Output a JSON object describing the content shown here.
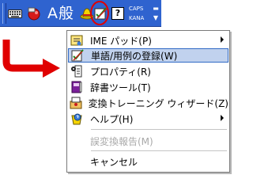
{
  "langbar": {
    "icons": {
      "keyboard": "keyboard-icon",
      "mode_button": "ime-toggle-icon",
      "tool": "ime-pad-hat-icon",
      "language": "register-word-icon",
      "help": "help-icon"
    },
    "input_mode": "A",
    "conversion_mode": "般",
    "help_label": "?",
    "caps_label": "CAPS",
    "kana_label": "KANA",
    "accent_color": "#2f63cf"
  },
  "menu": {
    "items": [
      {
        "label": "IME パッド(P)",
        "icon": "ime-pad-icon",
        "submenu": true,
        "enabled": true
      },
      {
        "label": "単語/用例の登録(W)",
        "icon": "register-word-icon",
        "submenu": false,
        "enabled": true,
        "highlighted": true
      },
      {
        "label": "プロパティ(R)",
        "icon": "properties-icon",
        "submenu": false,
        "enabled": true
      },
      {
        "label": "辞書ツール(T)",
        "icon": "dictionary-tool-icon",
        "submenu": false,
        "enabled": true
      },
      {
        "label": "変換トレーニング ウィザード(Z)",
        "icon": "training-wizard-icon",
        "submenu": false,
        "enabled": true
      },
      {
        "label": "ヘルプ(H)",
        "icon": "help-icon",
        "submenu": true,
        "enabled": true
      },
      {
        "label": "誤変換報告(M)",
        "icon": "",
        "submenu": false,
        "enabled": false
      },
      {
        "label": "キャンセル",
        "icon": "",
        "submenu": false,
        "enabled": true
      }
    ],
    "highlight_color": "#c1d2ee",
    "highlight_border": "#316ac5"
  }
}
